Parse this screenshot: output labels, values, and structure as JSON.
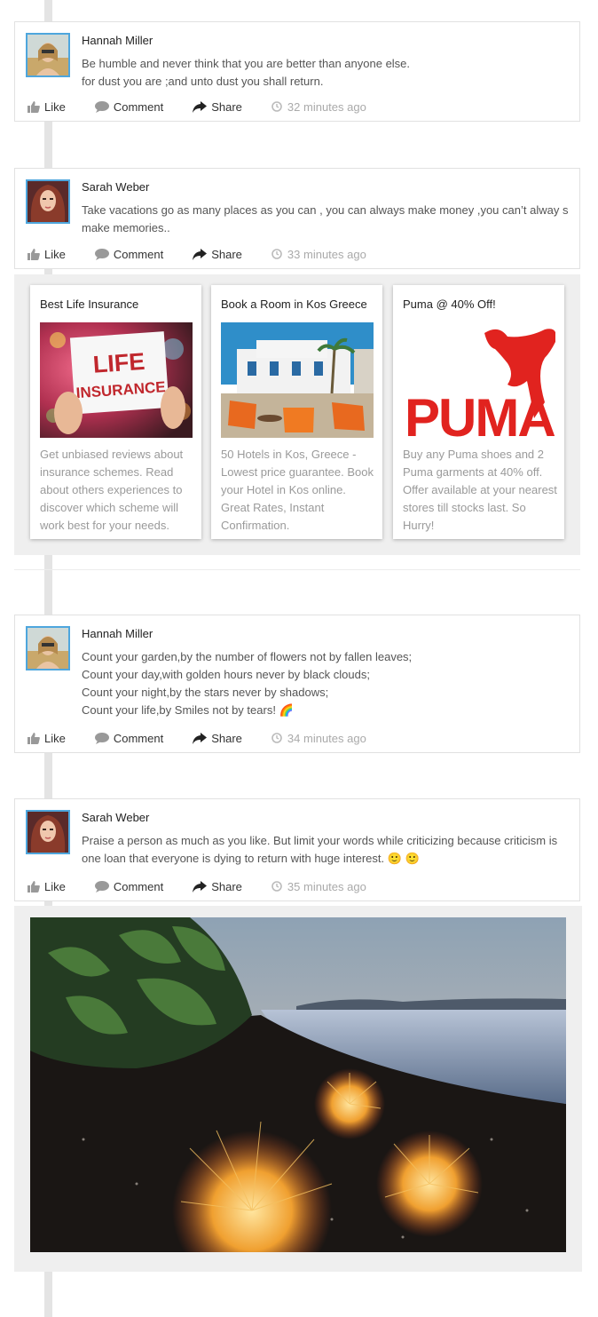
{
  "actions": {
    "like": "Like",
    "comment": "Comment",
    "share": "Share"
  },
  "posts": [
    {
      "author": "Hannah Miller",
      "text": "Be humble and never think that you are better than anyone else.\nfor dust you are ;and unto dust you shall return.",
      "time": "32 minutes ago"
    },
    {
      "author": "Sarah Weber",
      "text": "Take vacations go as many places as you can , you can always make money ,you can’t alway s make memories..",
      "time": "33 minutes ago"
    },
    {
      "author": "Hannah Miller",
      "text": "Count your garden,by the number of flowers not by fallen leaves;\nCount your day,with golden hours never by black clouds;\nCount your night,by the stars never by shadows;\nCount your life,by Smiles not by tears! 🌈",
      "time": "34 minutes ago"
    },
    {
      "author": "Sarah Weber",
      "text": "Praise a person as much as you like. But limit your words while criticizing because criticism is one loan that everyone is dying to return with huge interest. 🙂 🙂",
      "time": "35 minutes ago"
    }
  ],
  "ads": [
    {
      "title": "Best Life Insurance",
      "image_text": "LIFE\nINSURANCE",
      "description": "Get unbiased reviews about insurance schemes. Read about others experiences to discover which scheme will work best for your needs."
    },
    {
      "title": "Book a Room in Kos Greece",
      "description": "50 Hotels in Kos, Greece - Lowest price guarantee. Book your Hotel in Kos online. Great Rates, Instant Confirmation."
    },
    {
      "title": "Puma @ 40% Off!",
      "image_text": "PUMA",
      "description": "Buy any Puma shoes and 2 Puma garments at 40% off. Offer available at your nearest stores till stocks last. So Hurry!"
    }
  ],
  "colors": {
    "avatar_border": "#4ea6dd",
    "puma_red": "#e1231f",
    "timeline": "#e4e4e4"
  },
  "icons": [
    "thumbs-up-icon",
    "comment-bubble-icon",
    "share-arrow-icon",
    "clock-icon"
  ]
}
